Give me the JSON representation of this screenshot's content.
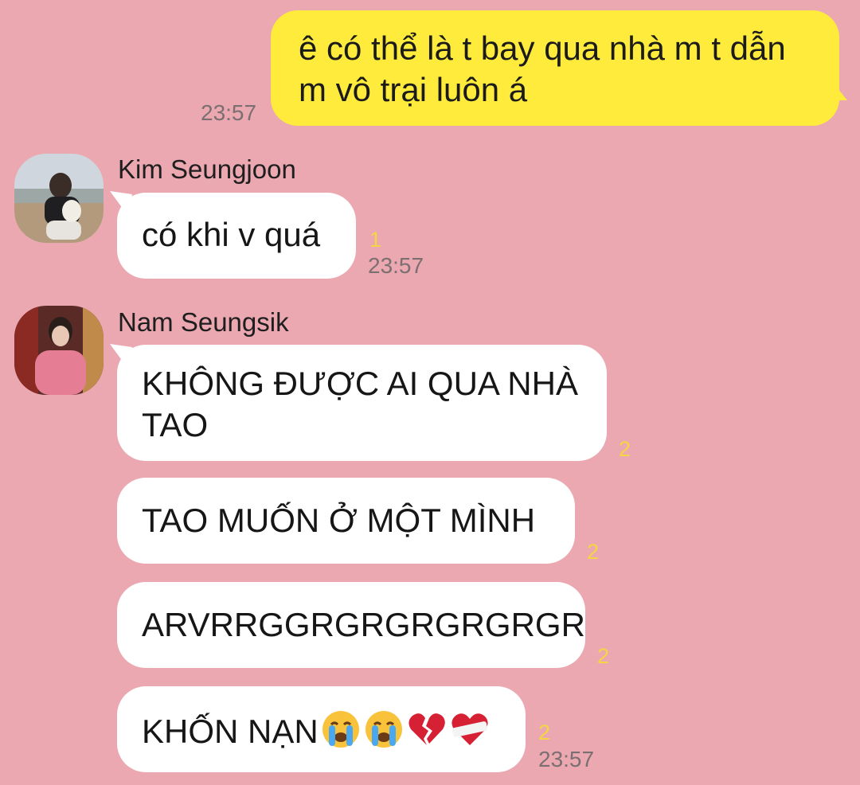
{
  "outgoing": {
    "text": "ê có thể là t bay qua nhà m t dẫn m vô trại luôn á",
    "time": "23:57"
  },
  "groups": [
    {
      "sender": "Kim Seungjoon",
      "messages": [
        {
          "text": "có khi v quá",
          "unread": "1",
          "time": "23:57"
        }
      ]
    },
    {
      "sender": "Nam Seungsik",
      "messages": [
        {
          "text": "KHÔNG ĐƯỢC AI QUA NHÀ TAO",
          "unread": "2"
        },
        {
          "text": "TAO MUỐN Ở MỘT MÌNH",
          "unread": "2"
        },
        {
          "text": "ARVRRGGRGRGRGRGRGR",
          "unread": "2"
        },
        {
          "text": "KHỐN NẠN",
          "emojis": [
            "crying-face-emoji",
            "crying-face-emoji",
            "broken-heart-emoji",
            "mending-heart-emoji"
          ],
          "unread": "2",
          "time": "23:57"
        }
      ]
    }
  ],
  "colors": {
    "background": "#eba8b1",
    "outgoing_bubble": "#ffeb3b",
    "incoming_bubble": "#ffffff",
    "unread_count": "#f4d645",
    "timestamp": "#7b6f71"
  }
}
